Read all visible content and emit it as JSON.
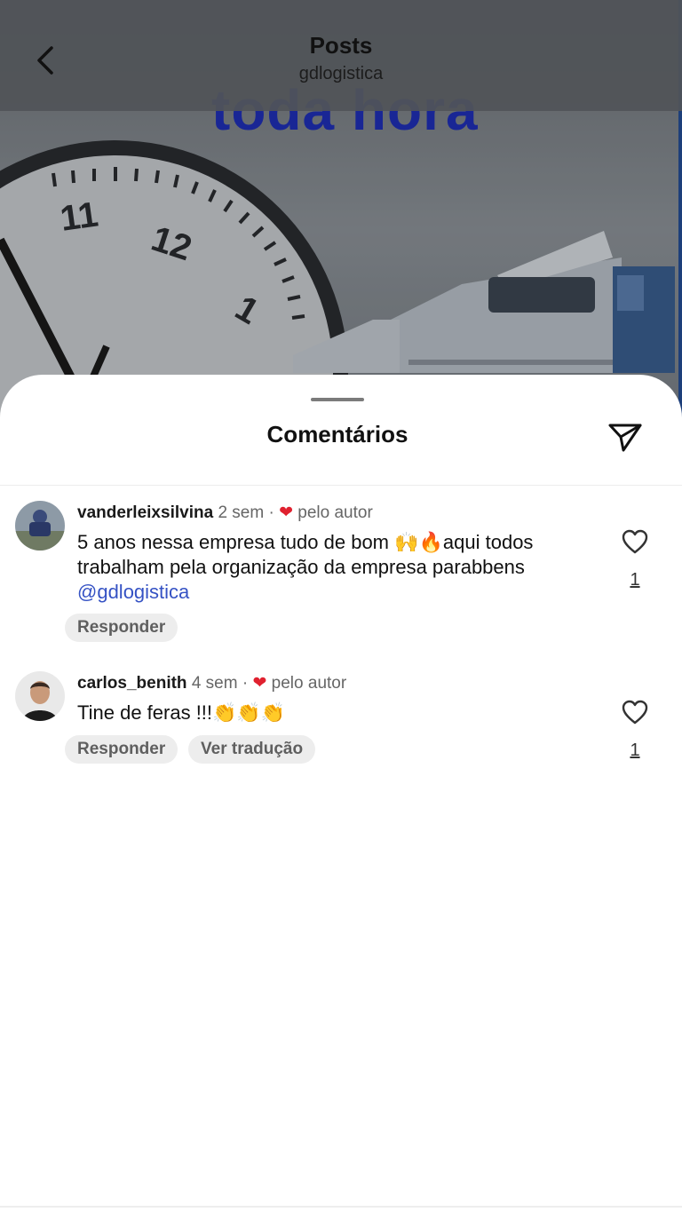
{
  "header": {
    "title": "Posts",
    "subtitle": "gdlogistica"
  },
  "post_image": {
    "visible_text": "toda hora",
    "clock_numerals": [
      "11",
      "12",
      "1"
    ]
  },
  "sheet": {
    "title": "Comentários"
  },
  "comments": [
    {
      "username": "vanderleixsilvina",
      "time": "2 sem",
      "separator": "·",
      "liked_by": "pelo autor",
      "text_main": "5 anos nessa empresa tudo de bom 🙌🔥aqui todos trabalham pela organização da empresa parabbens ",
      "mention": "@gdlogistica",
      "reply_label": "Responder",
      "like_count": "1"
    },
    {
      "username": "carlos_benith",
      "time": "4 sem",
      "separator": "·",
      "liked_by": "pelo autor",
      "text_main": "Tine de feras !!!👏👏👏",
      "reply_label": "Responder",
      "translate_label": "Ver tradução",
      "like_count": "1"
    }
  ],
  "icons": {
    "back": "chevron-left-icon",
    "share": "paper-plane-icon",
    "like": "heart-outline-icon",
    "liked_by_author": "heart-filled-icon"
  },
  "colors": {
    "accent_link": "#3552c4",
    "author_heart": "#e0212f",
    "chip_bg": "#ededed"
  }
}
